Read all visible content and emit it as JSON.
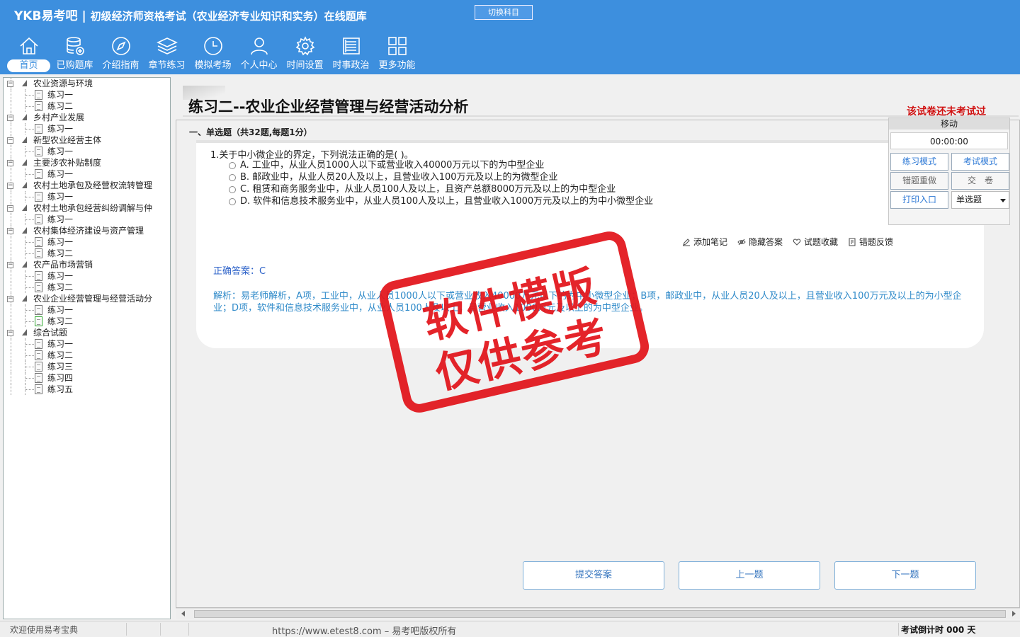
{
  "header": {
    "brand": "YKB易考吧",
    "subtitle": "初级经济师资格考试（农业经济专业知识和实务）在线题库",
    "switch_subject": "切换科目"
  },
  "nav": [
    {
      "label": "首页",
      "icon": "home-icon"
    },
    {
      "label": "已购题库",
      "icon": "database-icon"
    },
    {
      "label": "介绍指南",
      "icon": "compass-icon"
    },
    {
      "label": "章节练习",
      "icon": "layers-icon"
    },
    {
      "label": "模拟考场",
      "icon": "clock-icon"
    },
    {
      "label": "个人中心",
      "icon": "user-icon"
    },
    {
      "label": "时间设置",
      "icon": "gear-icon"
    },
    {
      "label": "时事政治",
      "icon": "news-icon"
    },
    {
      "label": "更多功能",
      "icon": "grid-icon"
    }
  ],
  "tree": [
    {
      "label": "农业资源与环境",
      "children": [
        "练习一",
        "练习二"
      ]
    },
    {
      "label": "乡村产业发展",
      "children": [
        "练习一"
      ]
    },
    {
      "label": "新型农业经营主体",
      "children": [
        "练习一"
      ]
    },
    {
      "label": "主要涉农补贴制度",
      "children": [
        "练习一"
      ]
    },
    {
      "label": "农村土地承包及经营权流转管理",
      "children": [
        "练习一"
      ]
    },
    {
      "label": "农村土地承包经营纠纷调解与仲",
      "children": [
        "练习一"
      ]
    },
    {
      "label": "农村集体经济建设与资产管理",
      "children": [
        "练习一",
        "练习二"
      ]
    },
    {
      "label": "农产品市场营销",
      "children": [
        "练习一",
        "练习二"
      ]
    },
    {
      "label": "农业企业经营管理与经营活动分",
      "children": [
        "练习一",
        "练习二"
      ]
    },
    {
      "label": "综合试题",
      "children": [
        "练习一",
        "练习二",
        "练习三",
        "练习四",
        "练习五"
      ]
    }
  ],
  "main": {
    "title": "练习二--农业企业经营管理与经营活动分析",
    "status": "该试卷还未考试过",
    "section": "一、单选题（共32题,每题1分）",
    "question": "1.关于中小微企业的界定，下列说法正确的是( )。",
    "options": [
      "A. 工业中，从业人员1000人以下或营业收入40000万元以下的为中型企业",
      "B. 邮政业中，从业人员20人及以上，且营业收入100万元及以上的为微型企业",
      "C. 租赁和商务服务业中，从业人员100人及以上，且资产总额8000万元及以上的为中型企业",
      "D. 软件和信息技术服务业中，从业人员100人及以上，且营业收入1000万元及以上的为中小微型企业"
    ],
    "actions": {
      "note": "添加笔记",
      "hide_answer": "隐藏答案",
      "favorite": "试题收藏",
      "feedback": "错题反馈"
    },
    "answer": "正确答案：C",
    "analysis": "解析：易老师解析，A项，工业中，从业人员1000人以下或营业收入40000万元以下的为中小微型企业；B项，邮政业中，从业人员20人及以上，且营业收入100万元及以上的为小型企业；D项，软件和信息技术服务业中，从业人员100人及以上，且营业收入1000万元及以上的为中型企业。"
  },
  "panel": {
    "move": "移动",
    "timer": "00:00:00",
    "practice_mode": "练习模式",
    "exam_mode": "考试模式",
    "redo_wrong": "错题重做",
    "submit_paper": "交　卷",
    "print": "打印入口",
    "question_type": "单选题"
  },
  "bottom": {
    "submit": "提交答案",
    "prev": "上一题",
    "next": "下一题"
  },
  "statusbar": {
    "welcome": "欢迎使用易考宝典",
    "copyright": "https://www.etest8.com – 易考吧版权所有",
    "countdown": "考试倒计时 000 天"
  },
  "watermark": {
    "line1": "软件模版",
    "line2": "仅供参考"
  },
  "colors": {
    "header_bg": "#3d8fde",
    "status_red": "#d01010",
    "answer_blue": "#2a60c8",
    "stamp_red": "#e2141a"
  }
}
